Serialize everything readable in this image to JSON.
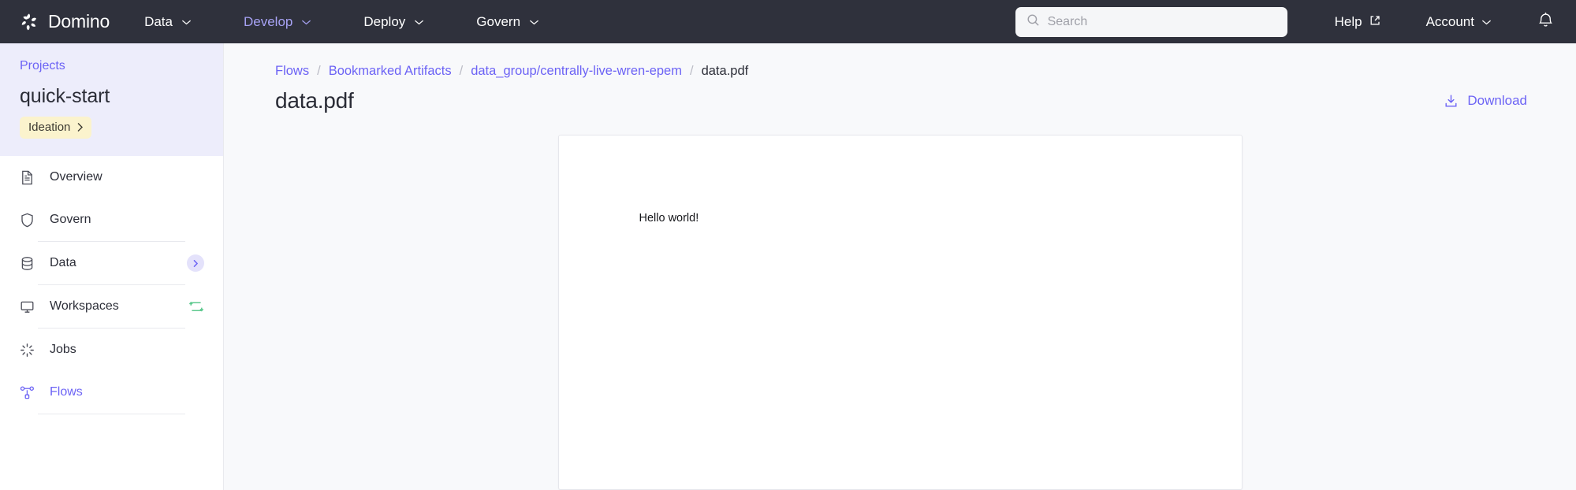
{
  "topbar": {
    "brand": "Domino",
    "brand_icon": "domino-pinwheel-logo",
    "nav": [
      {
        "label": "Data",
        "icon": "chevron-down-icon",
        "active": false
      },
      {
        "label": "Develop",
        "icon": "chevron-down-icon",
        "active": true
      },
      {
        "label": "Deploy",
        "icon": "chevron-down-icon",
        "active": false
      },
      {
        "label": "Govern",
        "icon": "chevron-down-icon",
        "active": false
      }
    ],
    "search": {
      "placeholder": "Search",
      "value": "",
      "icon": "search-icon"
    },
    "help": {
      "label": "Help",
      "icon": "external-link-icon"
    },
    "account": {
      "label": "Account",
      "icon": "chevron-down-icon"
    },
    "notifications_icon": "bell-icon",
    "colors": {
      "background": "#2f313c",
      "active_nav": "#a7a2f4"
    }
  },
  "sidebar": {
    "projects_link": "Projects",
    "project_name": "quick-start",
    "stage_badge": {
      "label": "Ideation",
      "icon": "chevron-right-icon",
      "color": "#fbf3cd"
    },
    "items": [
      {
        "label": "Overview",
        "icon": "document-icon",
        "active": false,
        "badge": null
      },
      {
        "label": "Govern",
        "icon": "shield-icon",
        "active": false,
        "badge": null
      },
      {
        "label": "Data",
        "icon": "database-icon",
        "active": false,
        "badge": "chevron-right-badge"
      },
      {
        "label": "Workspaces",
        "icon": "monitor-icon",
        "active": false,
        "badge": "sync-icon"
      },
      {
        "label": "Jobs",
        "icon": "spinner-icon",
        "active": false,
        "badge": null
      },
      {
        "label": "Flows",
        "icon": "node-graph-icon",
        "active": true,
        "badge": null
      }
    ],
    "colors": {
      "header_background": "#ededfb",
      "active": "#6c63f5",
      "badge_green": "#5ec98f"
    }
  },
  "main": {
    "breadcrumb": [
      {
        "label": "Flows",
        "link": true
      },
      {
        "label": "Bookmarked Artifacts",
        "link": true
      },
      {
        "label": "data_group/centrally-live-wren-epem",
        "link": true
      },
      {
        "label": "data.pdf",
        "link": false
      }
    ],
    "breadcrumb_separator": "/",
    "page_title": "data.pdf",
    "download": {
      "label": "Download",
      "icon": "download-icon"
    },
    "document": {
      "body_text": "Hello world!"
    }
  }
}
